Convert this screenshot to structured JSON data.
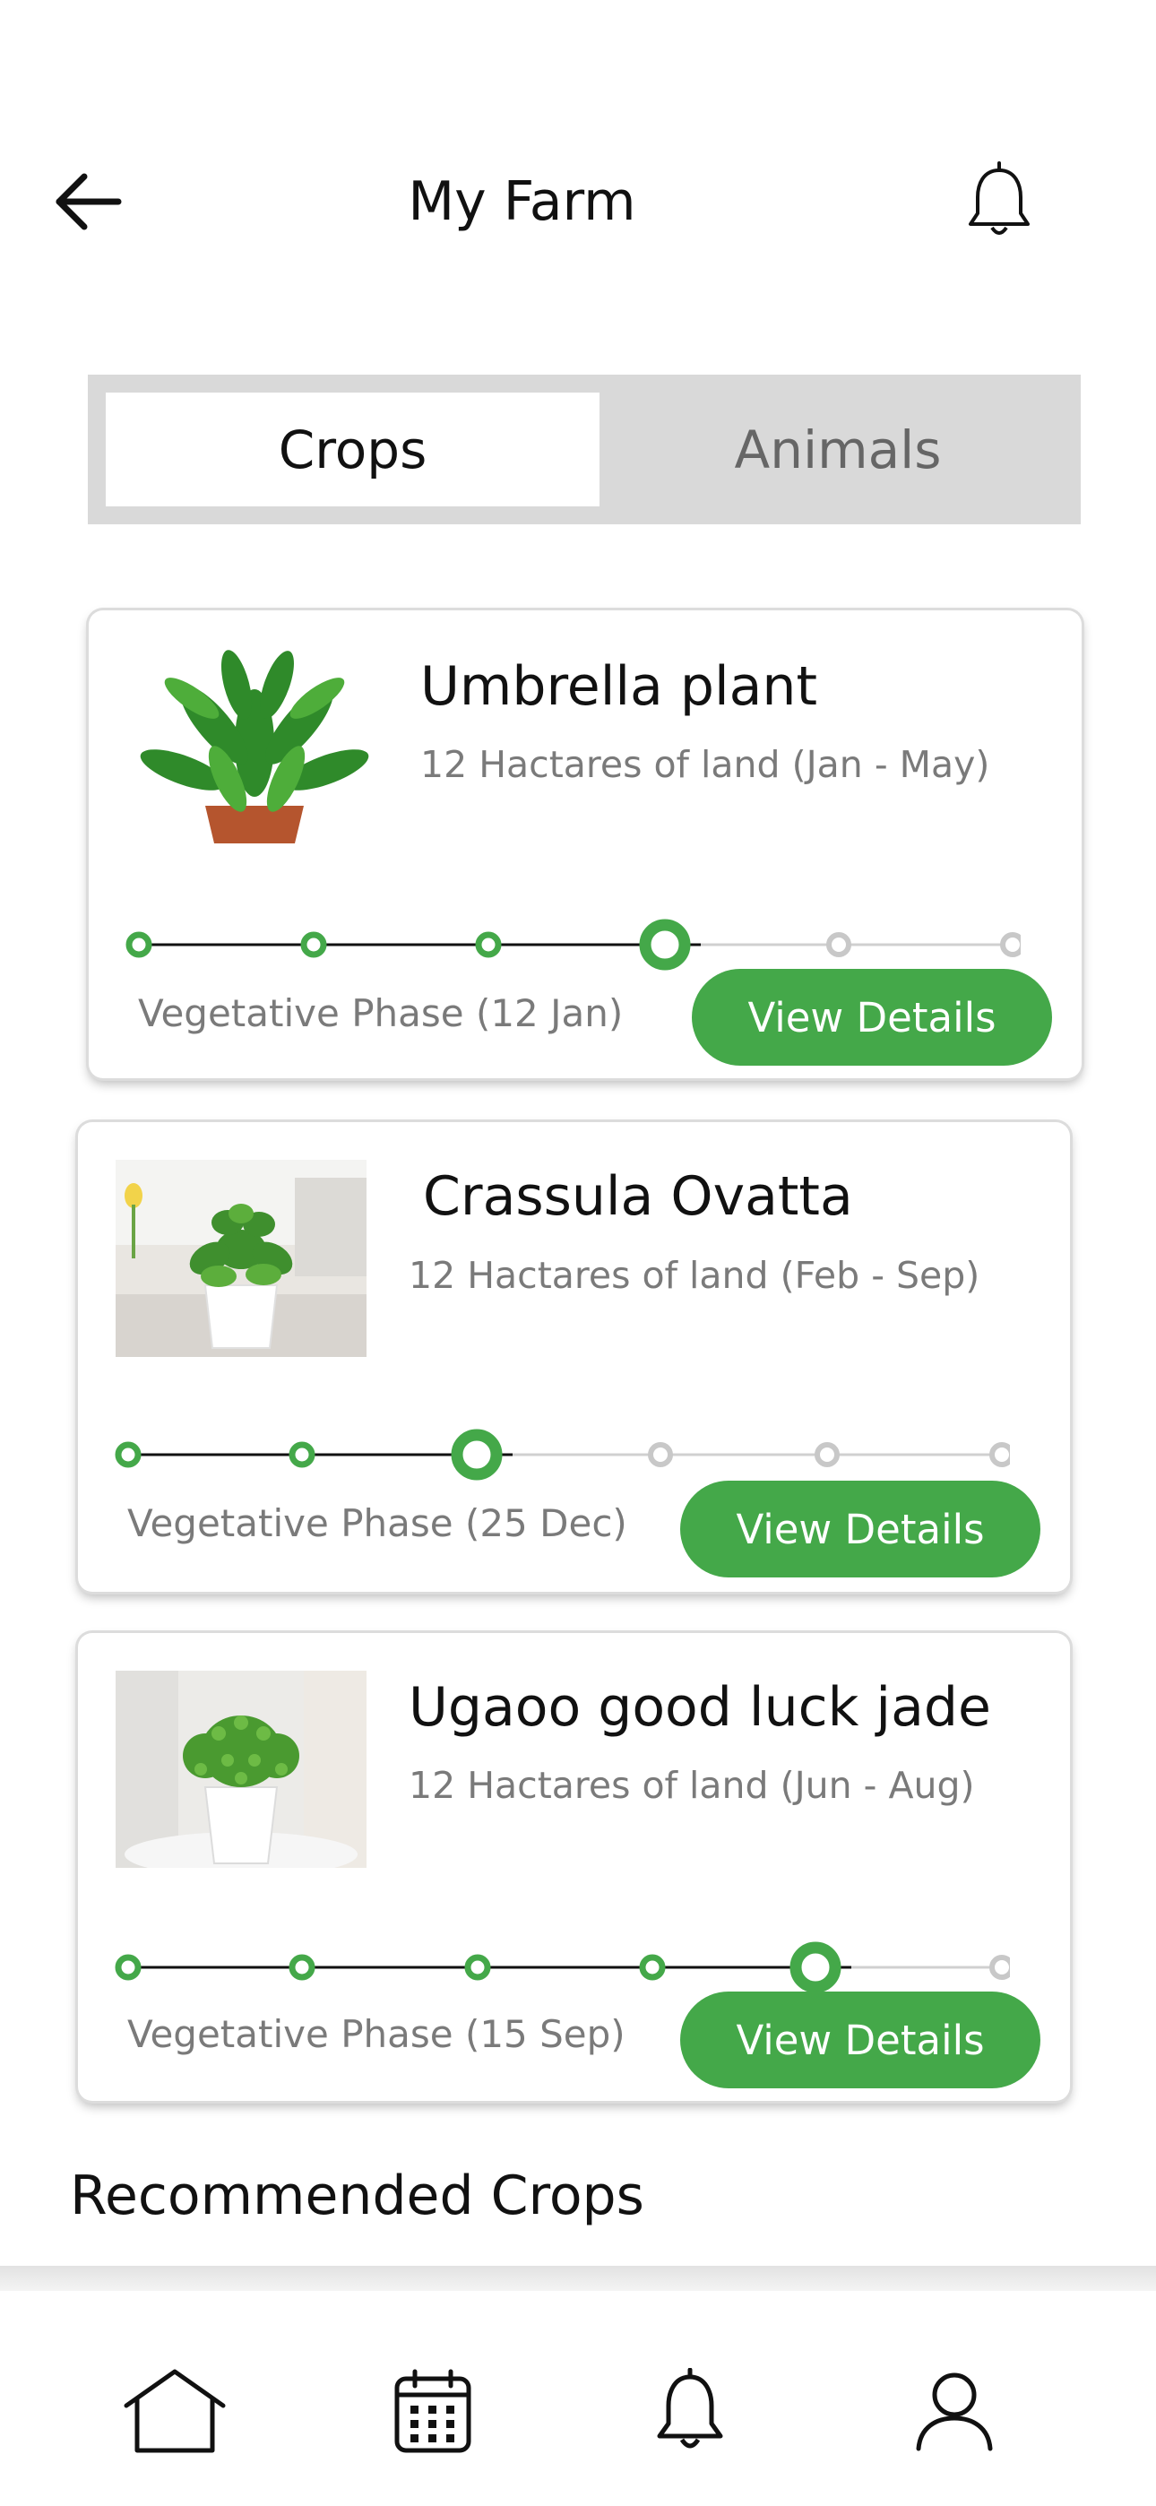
{
  "header": {
    "title": "My Farm",
    "back_icon": "arrow-left-icon",
    "notification_icon": "bell-icon"
  },
  "tabs": [
    {
      "label": "Crops",
      "selected": true
    },
    {
      "label": "Animals",
      "selected": false
    }
  ],
  "crops": [
    {
      "name": "Umbrella plant",
      "land": "12 Hactares of land (Jan - May)",
      "phase": "Vegetative Phase (12 Jan)",
      "button": "View Details",
      "stages_total": 6,
      "current_stage": 4
    },
    {
      "name": "Crassula Ovatta",
      "land": "12 Hactares of land (Feb - Sep)",
      "phase": "Vegetative Phase (25 Dec)",
      "button": "View Details",
      "stages_total": 6,
      "current_stage": 3
    },
    {
      "name": "Ugaoo good luck jade",
      "land": "12 Hactares of land (Jun - Aug)",
      "phase": "Vegetative Phase (15 Sep)",
      "button": "View Details",
      "stages_total": 6,
      "current_stage": 5
    }
  ],
  "recommended": {
    "title": "Recommended Crops"
  },
  "bottom_nav": [
    {
      "icon": "home-icon"
    },
    {
      "icon": "calendar-icon"
    },
    {
      "icon": "bell-icon"
    },
    {
      "icon": "user-icon"
    }
  ],
  "colors": {
    "accent": "#44a849",
    "tab_bg": "#d9d9d9",
    "inactive": "#c8c8c8"
  }
}
